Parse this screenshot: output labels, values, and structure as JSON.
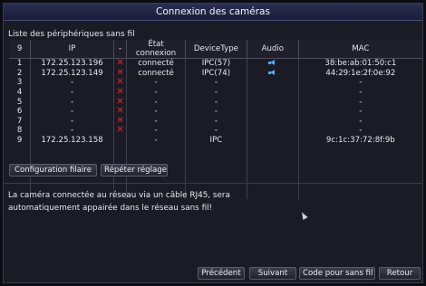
{
  "window": {
    "title": "Connexion des caméras"
  },
  "device_list": {
    "title": "Liste des périphériques sans fil",
    "columns": [
      "9",
      "IP",
      "-",
      "État connexion",
      "DeviceType",
      "Audio",
      "MAC"
    ],
    "rows": [
      {
        "no": "1",
        "ip": "172.25.123.196",
        "disconnected": true,
        "state": "connecté",
        "type": "IPC(57)",
        "audio": true,
        "mac": "38:be:ab:01:50:c1"
      },
      {
        "no": "2",
        "ip": "172.25.123.149",
        "disconnected": true,
        "state": "connecté",
        "type": "IPC(74)",
        "audio": true,
        "mac": "44:29:1e:2f:0e:92"
      },
      {
        "no": "3",
        "ip": "-",
        "disconnected": true,
        "state": "-",
        "type": "-",
        "audio": false,
        "mac": "-"
      },
      {
        "no": "4",
        "ip": "-",
        "disconnected": true,
        "state": "-",
        "type": "-",
        "audio": false,
        "mac": "-"
      },
      {
        "no": "5",
        "ip": "-",
        "disconnected": true,
        "state": "-",
        "type": "-",
        "audio": false,
        "mac": "-"
      },
      {
        "no": "6",
        "ip": "-",
        "disconnected": true,
        "state": "-",
        "type": "-",
        "audio": false,
        "mac": "-"
      },
      {
        "no": "7",
        "ip": "-",
        "disconnected": true,
        "state": "-",
        "type": "-",
        "audio": false,
        "mac": "-"
      },
      {
        "no": "8",
        "ip": "-",
        "disconnected": true,
        "state": "-",
        "type": "-",
        "audio": false,
        "mac": "-"
      },
      {
        "no": "9",
        "ip": "172.25.123.158",
        "disconnected": false,
        "state": "-",
        "type": "IPC",
        "audio": false,
        "mac": "9c:1c:37:72:8f:9b"
      }
    ]
  },
  "actions": {
    "wired_config": "Configuration filaire",
    "repeat_setting": "Répéter réglage"
  },
  "info_text": {
    "line1": "La caméra connectée au réseau via un câble RJ45, sera",
    "line2": "automatiquement appairée dans le réseau sans fil!"
  },
  "footer": {
    "previous": "Précédent",
    "next": "Suivant",
    "wireless_code": "Code pour sans fil",
    "back": "Retour"
  },
  "colors": {
    "disconnect_mark": "#e02626",
    "audio_icon": "#5aa8e8",
    "titlebar": "#222848"
  },
  "icons": {
    "disconnect": "x-mark-icon",
    "audio": "speaker-icon",
    "cursor": "mouse-cursor-icon"
  }
}
